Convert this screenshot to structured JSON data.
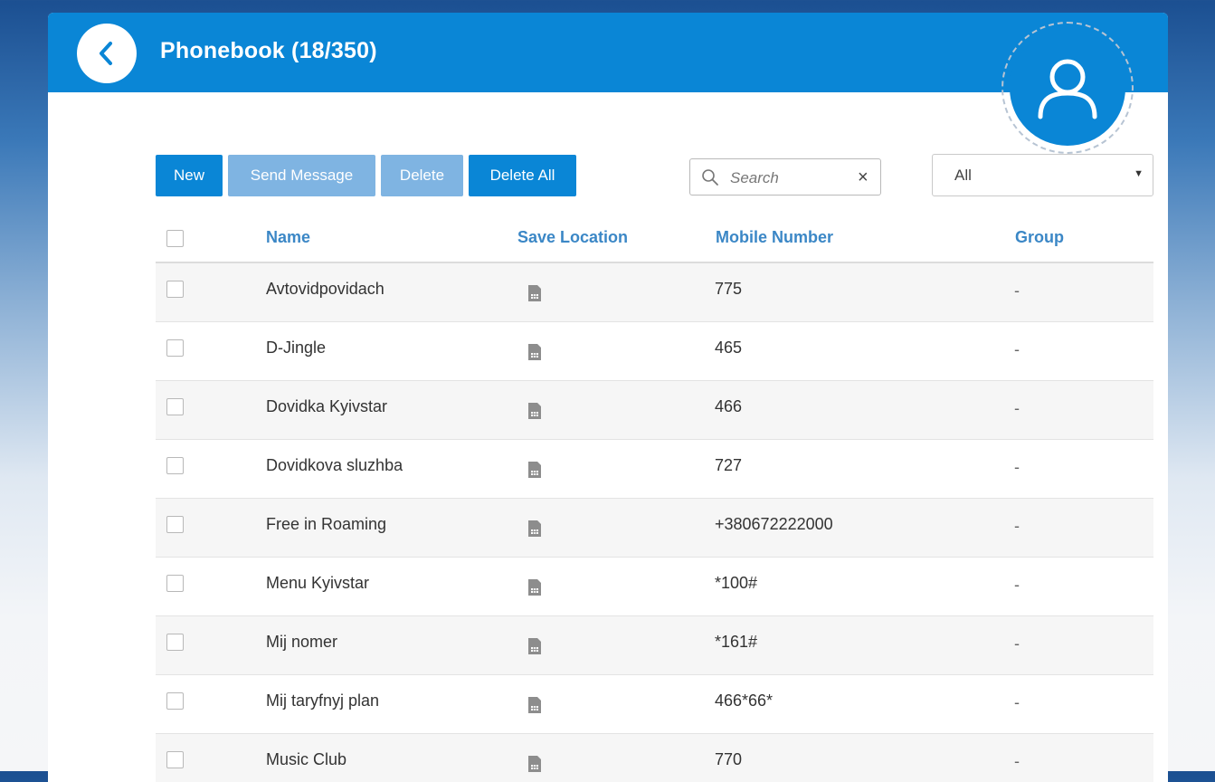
{
  "header": {
    "title": "Phonebook (18/350)"
  },
  "toolbar": {
    "new_label": "New",
    "send_message_label": "Send Message",
    "delete_label": "Delete",
    "delete_all_label": "Delete All"
  },
  "search": {
    "placeholder": "Search",
    "value": ""
  },
  "filter": {
    "selected": "All"
  },
  "table": {
    "columns": [
      "Name",
      "Save Location",
      "Mobile Number",
      "Group"
    ],
    "rows": [
      {
        "name": "Avtovidpovidach",
        "location_icon": "sim-card-icon",
        "number": "775",
        "group": "-"
      },
      {
        "name": "D-Jingle",
        "location_icon": "sim-card-icon",
        "number": "465",
        "group": "-"
      },
      {
        "name": "Dovidka Kyivstar",
        "location_icon": "sim-card-icon",
        "number": "466",
        "group": "-"
      },
      {
        "name": "Dovidkova sluzhba",
        "location_icon": "sim-card-icon",
        "number": "727",
        "group": "-"
      },
      {
        "name": "Free in Roaming",
        "location_icon": "sim-card-icon",
        "number": "+380672222000",
        "group": "-"
      },
      {
        "name": "Menu Kyivstar",
        "location_icon": "sim-card-icon",
        "number": "*100#",
        "group": "-"
      },
      {
        "name": "Mij nomer",
        "location_icon": "sim-card-icon",
        "number": "*161#",
        "group": "-"
      },
      {
        "name": "Mij taryfnyj plan",
        "location_icon": "sim-card-icon",
        "number": "466*66*",
        "group": "-"
      },
      {
        "name": "Music Club",
        "location_icon": "sim-card-icon",
        "number": "770",
        "group": "-"
      }
    ]
  },
  "colors": {
    "primary": "#0a86d6",
    "disabled_button": "#7fb4e2",
    "header_text": "#3b87c6"
  }
}
